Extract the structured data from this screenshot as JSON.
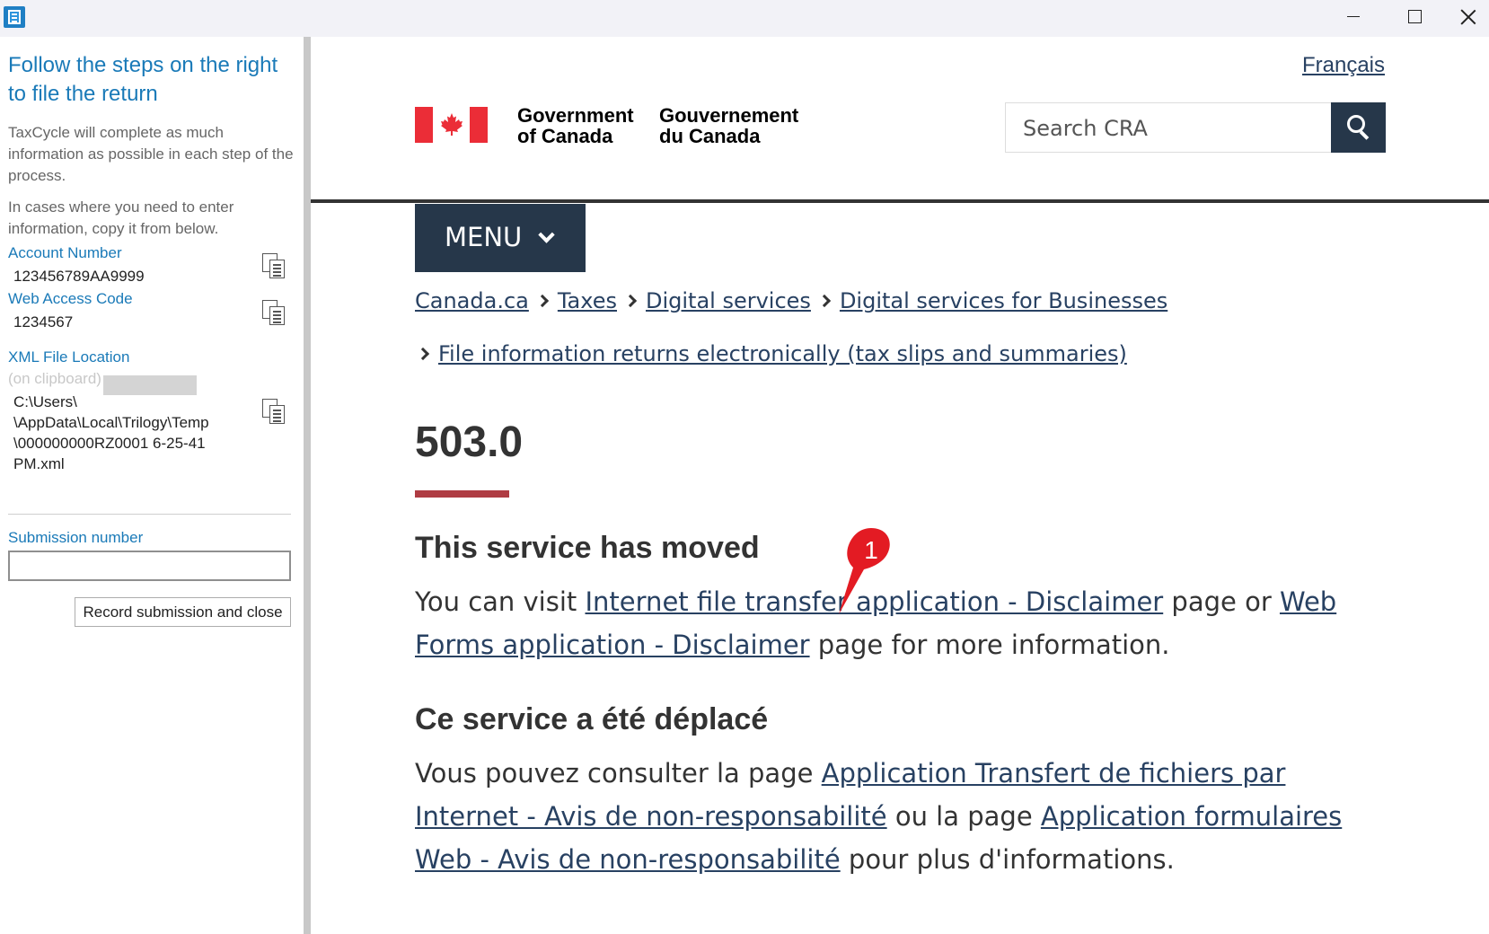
{
  "window": {
    "app_icon": "taxcycle-app-icon",
    "controls": [
      "minimize-icon",
      "maximize-icon",
      "close-icon"
    ]
  },
  "left_panel": {
    "heading": "Follow the steps on the right to file the return",
    "intro_text": "TaxCycle will complete as much information as possible in each step of the process.",
    "copy_text": "In cases where you need to enter information, copy it from below.",
    "account_number": {
      "label": "Account Number",
      "value": "123456789AA9999"
    },
    "web_access_code": {
      "label": "Web Access Code",
      "value": "1234567"
    },
    "xml_file": {
      "label": "XML File Location",
      "hint": "(on clipboard)",
      "path_lines": [
        "C:\\Users\\",
        "\\AppData\\Local\\Trilogy\\Temp",
        "\\000000000RZ0001 6-25-41",
        "PM.xml"
      ]
    },
    "submission": {
      "label": "Submission number",
      "value": ""
    },
    "record_button": "Record submission and close"
  },
  "web": {
    "lang_link": "Français",
    "gov_en": [
      "Government",
      "of Canada"
    ],
    "gov_fr": [
      "Gouvernement",
      "du Canada"
    ],
    "search_placeholder": "Search CRA",
    "menu_label": "MENU",
    "breadcrumbs": [
      "Canada.ca",
      "Taxes",
      "Digital services",
      "Digital services for Businesses",
      "File information returns electronically (tax slips and summaries)"
    ],
    "page_title": "503.0",
    "en": {
      "heading": "This service has moved",
      "text1": "You can visit ",
      "link1": "Internet file transfer application - Disclaimer",
      "text2": " page or ",
      "link2": "Web Forms application - Disclaimer",
      "text3": " page for more information."
    },
    "fr": {
      "heading": "Ce service a été déplacé",
      "text1": "Vous pouvez consulter la page ",
      "link1": "Application Transfert de fichiers par Internet - Avis de non-responsabilité",
      "text2": " ou la page ",
      "link2": "Application formulaires Web - Avis de non-responsabilité",
      "text3": " pour plus d'informations."
    },
    "annotation_number": "1",
    "colors": {
      "accent": "#26374a",
      "link": "#284162",
      "title_bar": "#af3c43",
      "pin": "#e31b23"
    }
  }
}
